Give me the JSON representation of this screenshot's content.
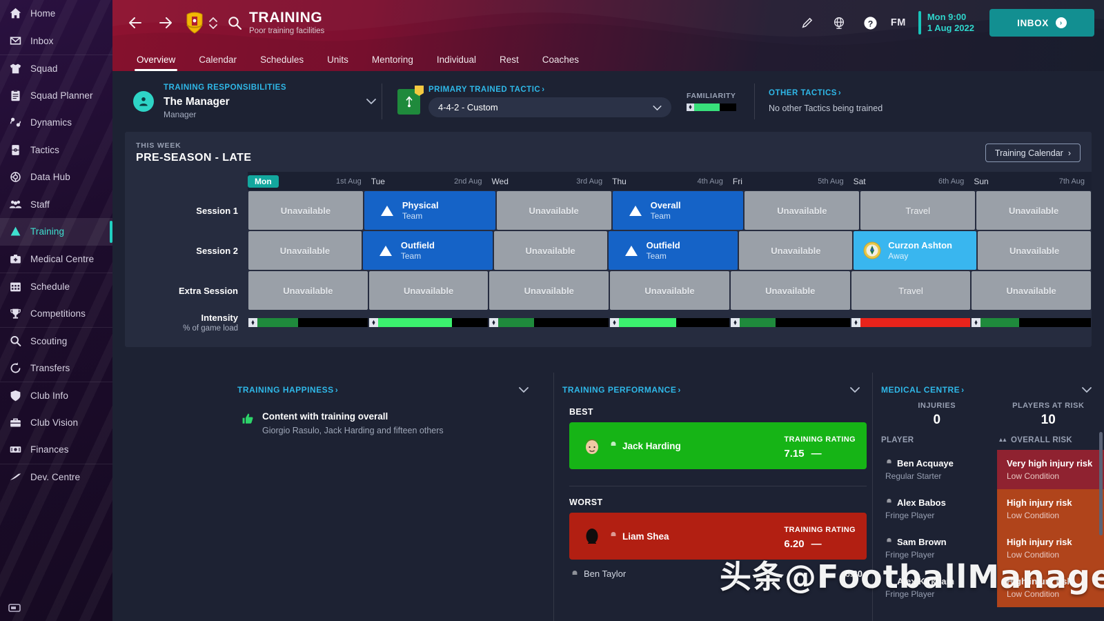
{
  "sidebar": {
    "items": [
      {
        "label": "Home",
        "icon": "home-icon",
        "group": 0
      },
      {
        "label": "Inbox",
        "icon": "inbox-icon",
        "group": 0
      },
      {
        "label": "Squad",
        "icon": "shirt-icon",
        "group": 1
      },
      {
        "label": "Squad Planner",
        "icon": "clipboard-icon",
        "group": 1
      },
      {
        "label": "Dynamics",
        "icon": "dynamics-icon",
        "group": 1
      },
      {
        "label": "Tactics",
        "icon": "tactics-icon",
        "group": 1
      },
      {
        "label": "Data Hub",
        "icon": "datahub-icon",
        "group": 1
      },
      {
        "label": "Staff",
        "icon": "staff-icon",
        "group": 1
      },
      {
        "label": "Training",
        "icon": "training-icon",
        "group": 1,
        "active": true
      },
      {
        "label": "Medical Centre",
        "icon": "medical-icon",
        "group": 1
      },
      {
        "label": "Schedule",
        "icon": "calendar-icon",
        "group": 2
      },
      {
        "label": "Competitions",
        "icon": "trophy-icon",
        "group": 2
      },
      {
        "label": "Scouting",
        "icon": "search-icon",
        "group": 3
      },
      {
        "label": "Transfers",
        "icon": "transfers-icon",
        "group": 3
      },
      {
        "label": "Club Info",
        "icon": "shield-icon",
        "group": 4
      },
      {
        "label": "Club Vision",
        "icon": "briefcase-icon",
        "group": 4
      },
      {
        "label": "Finances",
        "icon": "money-icon",
        "group": 4
      },
      {
        "label": "Dev. Centre",
        "icon": "growth-icon",
        "group": 5
      }
    ]
  },
  "header": {
    "title": "TRAINING",
    "subtitle": "Poor training facilities",
    "back_icon": "back-arrow-icon",
    "forward_icon": "forward-arrow-icon",
    "club_badge_icon": "club-badge-icon",
    "stepper_icon": "up-down-stepper-icon",
    "search_icon": "search-icon",
    "edit_icon": "pencil-icon",
    "globe_icon": "globe-icon",
    "help_icon": "help-icon",
    "fm_logo": "FM",
    "clock_time": "Mon 9:00",
    "clock_date": "1 Aug 2022",
    "inbox_label": "INBOX",
    "tabs": [
      {
        "label": "Overview",
        "active": true
      },
      {
        "label": "Calendar",
        "active": false
      },
      {
        "label": "Schedules",
        "active": false
      },
      {
        "label": "Units",
        "active": false
      },
      {
        "label": "Mentoring",
        "active": false
      },
      {
        "label": "Individual",
        "active": false
      },
      {
        "label": "Rest",
        "active": false
      },
      {
        "label": "Coaches",
        "active": false
      }
    ]
  },
  "responsibilities": {
    "section_label": "TRAINING RESPONSIBILITIES",
    "name": "The Manager",
    "role": "Manager",
    "avatar_icon": "manager-avatar-icon",
    "chevron_icon": "chevron-down-icon"
  },
  "primary_tactic": {
    "section_label": "PRIMARY TRAINED TACTIC",
    "selected": "4-4-2 - Custom",
    "icon": "pitch-arrow-icon",
    "chevron_icon": "chevron-down-icon",
    "familiarity_label": "FAMILIARITY",
    "familiarity_pct": 60,
    "familiarity_color": "#38e07b"
  },
  "other_tactics": {
    "section_label": "OTHER TACTICS",
    "text": "No other Tactics being trained"
  },
  "week": {
    "kicker": "THIS WEEK",
    "title": "PRE-SEASON - LATE",
    "calendar_button": "Training Calendar",
    "days": [
      {
        "name": "Mon",
        "date": "1st Aug",
        "today": true
      },
      {
        "name": "Tue",
        "date": "2nd Aug",
        "today": false
      },
      {
        "name": "Wed",
        "date": "3rd Aug",
        "today": false
      },
      {
        "name": "Thu",
        "date": "4th Aug",
        "today": false
      },
      {
        "name": "Fri",
        "date": "5th Aug",
        "today": false
      },
      {
        "name": "Sat",
        "date": "6th Aug",
        "today": false
      },
      {
        "name": "Sun",
        "date": "7th Aug",
        "today": false
      }
    ],
    "rows": [
      {
        "label": "Session 1",
        "cells": [
          {
            "kind": "unavail",
            "title": "Unavailable"
          },
          {
            "kind": "session",
            "title": "Physical",
            "sub": "Team"
          },
          {
            "kind": "unavail",
            "title": "Unavailable"
          },
          {
            "kind": "session",
            "title": "Overall",
            "sub": "Team"
          },
          {
            "kind": "unavail",
            "title": "Unavailable"
          },
          {
            "kind": "travel",
            "title": "Travel"
          },
          {
            "kind": "unavail",
            "title": "Unavailable"
          }
        ]
      },
      {
        "label": "Session 2",
        "cells": [
          {
            "kind": "unavail",
            "title": "Unavailable"
          },
          {
            "kind": "session",
            "title": "Outfield",
            "sub": "Team"
          },
          {
            "kind": "unavail",
            "title": "Unavailable"
          },
          {
            "kind": "session",
            "title": "Outfield",
            "sub": "Team"
          },
          {
            "kind": "unavail",
            "title": "Unavailable"
          },
          {
            "kind": "match",
            "title": "Curzon Ashton",
            "sub": "Away"
          },
          {
            "kind": "unavail",
            "title": "Unavailable"
          }
        ]
      },
      {
        "label": "Extra Session",
        "cells": [
          {
            "kind": "unavail",
            "title": "Unavailable"
          },
          {
            "kind": "unavail",
            "title": "Unavailable"
          },
          {
            "kind": "unavail",
            "title": "Unavailable"
          },
          {
            "kind": "unavail",
            "title": "Unavailable"
          },
          {
            "kind": "unavail",
            "title": "Unavailable"
          },
          {
            "kind": "travel",
            "title": "Travel"
          },
          {
            "kind": "unavail",
            "title": "Unavailable"
          }
        ]
      }
    ],
    "intensity_label": "Intensity",
    "intensity_sub": "% of game load",
    "intensity": [
      {
        "pct": 34,
        "color": "#1f8a3c"
      },
      {
        "pct": 62,
        "color": "#3bf06e"
      },
      {
        "pct": 30,
        "color": "#1f8a3c"
      },
      {
        "pct": 48,
        "color": "#3bf06e"
      },
      {
        "pct": 30,
        "color": "#1f8a3c"
      },
      {
        "pct": 100,
        "color": "#e8231b"
      },
      {
        "pct": 32,
        "color": "#1f8a3c"
      }
    ]
  },
  "training_happiness": {
    "section_label": "TRAINING HAPPINESS",
    "chevron_icon": "chevron-down-icon",
    "status_icon": "thumbs-up-icon",
    "status": "Content with training overall",
    "players": "Giorgio Rasulo, Jack Harding and fifteen others"
  },
  "training_performance": {
    "section_label": "TRAINING PERFORMANCE",
    "chevron_icon": "chevron-down-icon",
    "best_label": "BEST",
    "worst_label": "WORST",
    "rating_label": "TRAINING RATING",
    "best": {
      "name": "Jack Harding",
      "rating": "7.15",
      "trend": "—",
      "face_icon": "player-face-icon"
    },
    "worst": {
      "name": "Liam Shea",
      "rating": "6.20",
      "trend": "—",
      "face_icon": "player-silhouette-icon"
    },
    "extra_row": {
      "name": "Ben Taylor",
      "rating": "6.20"
    }
  },
  "medical_centre": {
    "section_label": "MEDICAL CENTRE",
    "chevron_icon": "chevron-down-icon",
    "stats": [
      {
        "label": "INJURIES",
        "value": "0"
      },
      {
        "label": "PLAYERS AT RISK",
        "value": "10"
      }
    ],
    "col_player": "PLAYER",
    "col_risk": "OVERALL RISK",
    "sort_icon": "sort-ascending-icon",
    "filter_icon": "chevron-down-icon",
    "rows": [
      {
        "name": "Ben Acquaye",
        "role": "Regular Starter",
        "risk": "Very high injury risk",
        "condition": "Low Condition",
        "color": "#8f2230"
      },
      {
        "name": "Alex Babos",
        "role": "Fringe Player",
        "risk": "High injury risk",
        "condition": "Low Condition",
        "color": "#b0441b"
      },
      {
        "name": "Sam Brown",
        "role": "Fringe Player",
        "risk": "High injury risk",
        "condition": "Low Condition",
        "color": "#b0441b"
      },
      {
        "name": "Alex Kirkham",
        "role": "Fringe Player",
        "risk": "High injury risk",
        "condition": "Low Condition",
        "color": "#b0441b"
      }
    ]
  },
  "watermark": {
    "cjk": "头条",
    "handle": "@FootballManager"
  }
}
